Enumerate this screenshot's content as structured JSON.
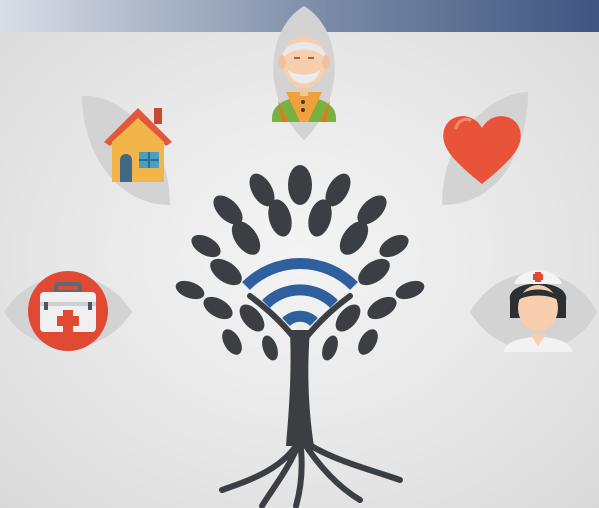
{
  "scene": {
    "icons": [
      {
        "id": "elderly-person",
        "icon": "elderly-person-icon"
      },
      {
        "id": "home",
        "icon": "house-icon"
      },
      {
        "id": "heart",
        "icon": "heart-icon"
      },
      {
        "id": "medical-kit",
        "icon": "first-aid-kit-icon"
      },
      {
        "id": "nurse",
        "icon": "nurse-icon"
      },
      {
        "id": "tree",
        "icon": "wifi-tree-icon"
      }
    ],
    "colors": {
      "background": "#e8e8e8",
      "top_bar_accent": "#3f5580",
      "leaf_backdrop": "#d3d3d3",
      "tree": "#3b3f44",
      "wifi": "#2f5f9e",
      "heart": "#e8533a",
      "house_roof": "#e1583c",
      "house_wall": "#f2b54a",
      "kit_red": "#e04a33",
      "elder_shirt_green": "#78b13f",
      "elder_vest_orange": "#f0a13b",
      "nurse_hair": "#2c2f33"
    }
  }
}
